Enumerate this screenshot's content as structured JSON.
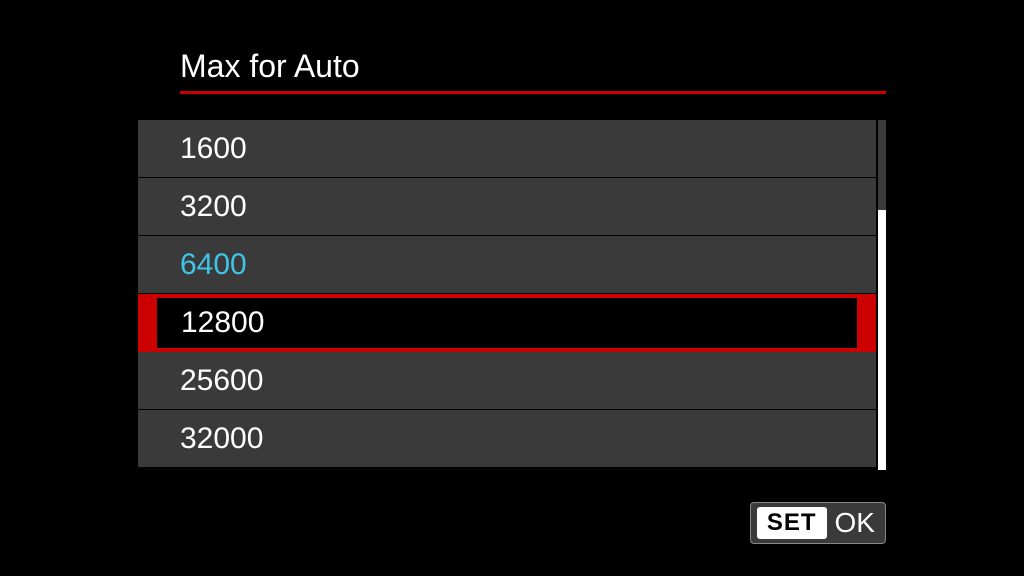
{
  "header": {
    "title": "Max for Auto"
  },
  "list": {
    "items": [
      {
        "label": "1600"
      },
      {
        "label": "3200"
      },
      {
        "label": "6400"
      },
      {
        "label": "12800"
      },
      {
        "label": "25600"
      },
      {
        "label": "32000"
      }
    ],
    "current_index": 2,
    "highlighted_index": 3
  },
  "footer": {
    "set_label": "SET",
    "ok_label": "OK"
  },
  "colors": {
    "accent": "#cc0000",
    "current_text": "#3fc4e8",
    "row_bg": "#3a3a3a"
  }
}
